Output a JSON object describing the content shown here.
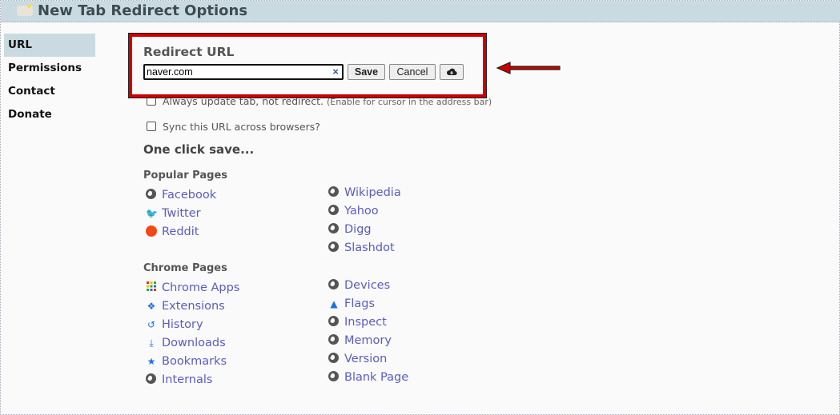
{
  "header": {
    "title": "New Tab Redirect Options"
  },
  "sidebar": {
    "items": [
      {
        "label": "URL",
        "active": true
      },
      {
        "label": "Permissions"
      },
      {
        "label": "Contact"
      },
      {
        "label": "Donate"
      }
    ]
  },
  "redirect": {
    "label": "Redirect URL",
    "value": "naver.com",
    "clear": "×",
    "save": "Save",
    "cancel": "Cancel",
    "cloud_icon": "cloud-download-icon",
    "highlight_color": "#cc0000"
  },
  "options": {
    "always_update": "Always update tab, not redirect.",
    "always_update_hint": "(Enable for cursor in the address bar)",
    "sync": "Sync this URL across browsers?"
  },
  "one_click": "One click save...",
  "popular": {
    "title": "Popular Pages",
    "left": [
      {
        "label": "Facebook",
        "icon": "globe"
      },
      {
        "label": "Twitter",
        "icon": "twitter"
      },
      {
        "label": "Reddit",
        "icon": "reddit"
      }
    ],
    "right": [
      {
        "label": "Wikipedia",
        "icon": "globe"
      },
      {
        "label": "Yahoo",
        "icon": "globe"
      },
      {
        "label": "Digg",
        "icon": "globe"
      },
      {
        "label": "Slashdot",
        "icon": "globe"
      }
    ]
  },
  "chrome": {
    "title": "Chrome Pages",
    "left": [
      {
        "label": "Chrome Apps",
        "icon": "apps"
      },
      {
        "label": "Extensions",
        "icon": "puzzle"
      },
      {
        "label": "History",
        "icon": "history"
      },
      {
        "label": "Downloads",
        "icon": "download"
      },
      {
        "label": "Bookmarks",
        "icon": "star"
      },
      {
        "label": "Internals",
        "icon": "globe"
      }
    ],
    "right": [
      {
        "label": "Devices",
        "icon": "globe"
      },
      {
        "label": "Flags",
        "icon": "flask"
      },
      {
        "label": "Inspect",
        "icon": "globe"
      },
      {
        "label": "Memory",
        "icon": "globe"
      },
      {
        "label": "Version",
        "icon": "globe"
      },
      {
        "label": "Blank Page",
        "icon": "globe"
      }
    ]
  },
  "link_color": "#5a5cc4"
}
